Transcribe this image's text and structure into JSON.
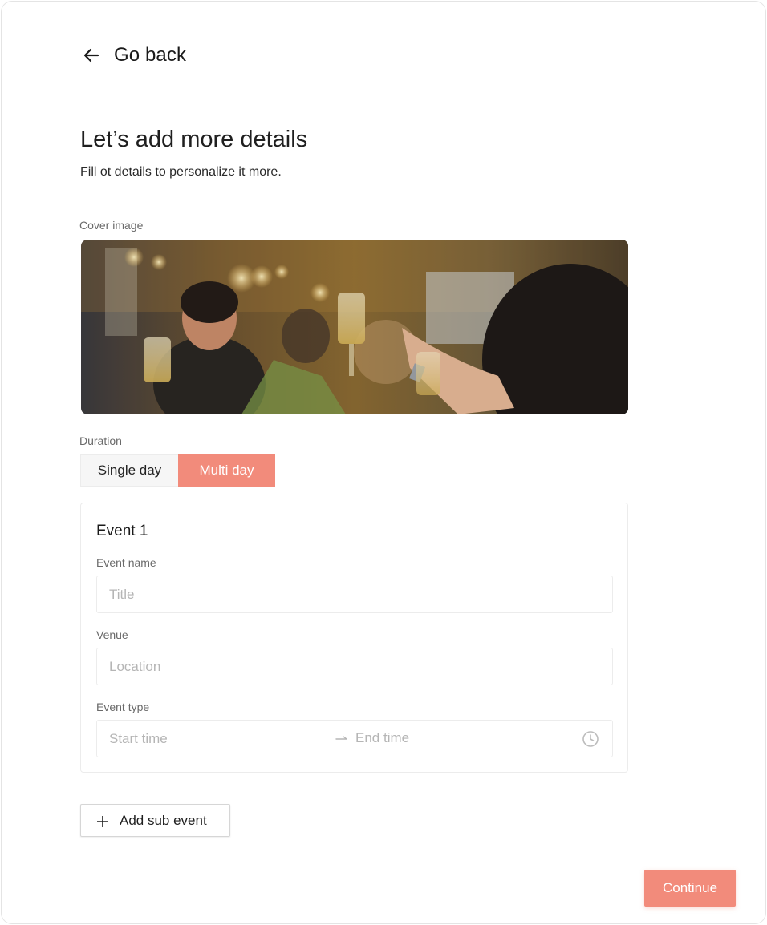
{
  "nav": {
    "back_label": "Go back",
    "back_icon": "arrow-left-icon"
  },
  "header": {
    "title": "Let’s add more details",
    "subtitle": "Fill ot details to personalize it more."
  },
  "cover": {
    "label": "Cover image"
  },
  "duration": {
    "label": "Duration",
    "options": [
      "Single day",
      "Multi day"
    ],
    "selected": "Multi day"
  },
  "event": {
    "title": "Event 1",
    "name_label": "Event name",
    "name_placeholder": "Title",
    "venue_label": "Venue",
    "venue_placeholder": "Location",
    "type_label": "Event type",
    "start_placeholder": "Start time",
    "end_placeholder": "End time"
  },
  "actions": {
    "add_sub_event": "Add sub event",
    "continue": "Continue"
  },
  "colors": {
    "accent": "#f28b7b",
    "border": "#ececec",
    "placeholder": "#b5b5b5"
  }
}
